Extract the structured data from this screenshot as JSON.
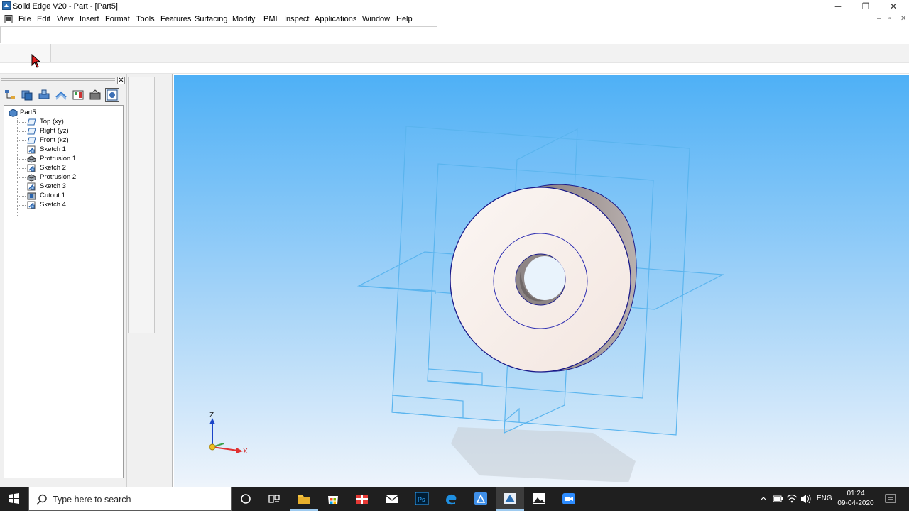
{
  "window": {
    "title": "Solid Edge V20 - Part - [Part5]",
    "controls": {
      "minimize": "─",
      "maximize": "❐",
      "close": "✕"
    }
  },
  "menu": {
    "items": [
      "File",
      "Edit",
      "View",
      "Insert",
      "Format",
      "Tools",
      "Features",
      "Surfacing",
      "Modify",
      "PMI",
      "Inspect",
      "Applications",
      "Window",
      "Help"
    ],
    "mdi_controls": {
      "minimize": "–",
      "restore": "▫",
      "close": "✕"
    }
  },
  "pathfinder": {
    "close_label": "✕",
    "toolbar_icons": [
      "feature-pathfinder-icon",
      "layers-icon",
      "sensors-icon",
      "feature-library-icon",
      "family-of-parts-icon",
      "feature-playback-icon",
      "reports-icon"
    ],
    "root": "Part5",
    "items": [
      {
        "label": "Top (xy)",
        "icon": "reference-plane-icon"
      },
      {
        "label": "Right (yz)",
        "icon": "reference-plane-icon"
      },
      {
        "label": "Front (xz)",
        "icon": "reference-plane-icon"
      },
      {
        "label": "Sketch 1",
        "icon": "sketch-icon"
      },
      {
        "label": "Protrusion 1",
        "icon": "protrusion-icon"
      },
      {
        "label": "Sketch 2",
        "icon": "sketch-icon"
      },
      {
        "label": "Protrusion 2",
        "icon": "protrusion-icon"
      },
      {
        "label": "Sketch 3",
        "icon": "sketch-icon"
      },
      {
        "label": "Cutout 1",
        "icon": "cutout-icon"
      },
      {
        "label": "Sketch 4",
        "icon": "sketch-icon"
      }
    ]
  },
  "viewport": {
    "triad": {
      "z_label": "Z",
      "x_label": "X"
    },
    "background_top": "#4eb0f6",
    "background_bottom": "#eef4fb",
    "plane_color": "#5ab4ee"
  },
  "taskbar": {
    "search_placeholder": "Type here to search",
    "apps": [
      "cortana-icon",
      "task-view-icon",
      "file-explorer-icon",
      "microsoft-store-icon",
      "gift-app-icon",
      "mail-icon",
      "photoshop-icon",
      "edge-icon",
      "app-icon",
      "solid-edge-icon",
      "photos-icon",
      "zoom-icon"
    ],
    "language": "ENG",
    "time": "01:24",
    "date": "09-04-2020"
  }
}
